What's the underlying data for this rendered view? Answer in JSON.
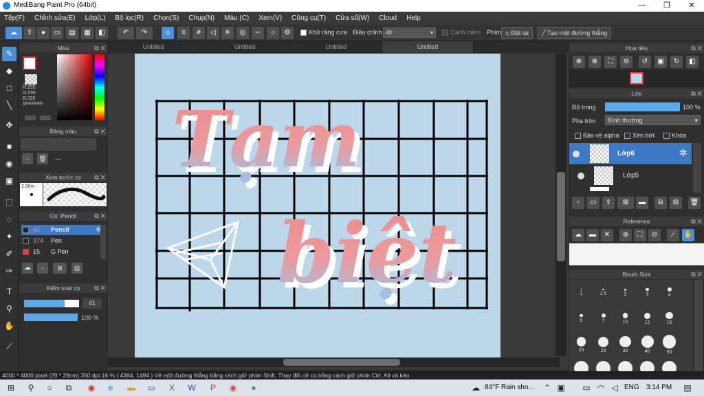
{
  "window": {
    "title": "MediBang Paint Pro (64bit)",
    "minimize": "—",
    "maximize": "❐",
    "close": "✕"
  },
  "menu": [
    "Tệp(F)",
    "Chỉnh sửa(E)",
    "Lớp(L)",
    "Bộ lọc(R)",
    "Chọn(S)",
    "Chụp(N)",
    "Màu (C)",
    "Xem(V)",
    "Công cụ(T)",
    "Cửa sổ(W)",
    "Cloud",
    "Help"
  ],
  "toolbar": {
    "antialias_label": "Khử răng cưa",
    "adjust_label": "Điều chỉnh",
    "adjust_value": "40",
    "soft_edge_label": "Cạnh mềm",
    "key_label": "Phím",
    "reset_label": "Đặt lại",
    "straight_line_label": "Tạo một đường thẳng"
  },
  "tabs": [
    "Untitled",
    "Untitled",
    "Untitled",
    "Untitled"
  ],
  "color_panel": {
    "title": "Màu",
    "r": "R:255",
    "g": "G:255",
    "b": "B:255",
    "hex": "#FFFFFF"
  },
  "palette_panel": {
    "title": "Bảng màu",
    "value": "---"
  },
  "preview_panel": {
    "title": "Xem trước cọ",
    "size": "2.98m"
  },
  "brush_panel": {
    "title": "Cọ: Pencil",
    "brushes": [
      {
        "size": "41",
        "name": "Pencil",
        "color": "#222222"
      },
      {
        "size": "374",
        "name": "Pen",
        "color": "#222222"
      },
      {
        "size": "15",
        "name": "G Pen",
        "color": "#e53935"
      }
    ]
  },
  "brush_control": {
    "title": "Kiểm soát cọ",
    "size_value": "41",
    "opacity_value": "100 %",
    "size_fraction": 0.74,
    "opacity_fraction": 1.0
  },
  "navigator_panel": {
    "title": "Hoa tiêu"
  },
  "layer_panel": {
    "title": "Lớp",
    "opacity_label": "Độ trong",
    "opacity_value": "100 %",
    "opacity_fraction": 1.0,
    "blend_label": "Pha trộn",
    "blend_value": "Bình thường",
    "protect_alpha": "Bảo vệ alpha",
    "clipping": "Xén bớt",
    "lock": "Khóa",
    "layers": [
      "Lớp6",
      "Lớp5"
    ]
  },
  "reference_panel": {
    "title": "Reference"
  },
  "brush_size_panel": {
    "title": "Brush Size",
    "sizes": [
      "1",
      "1.5",
      "2",
      "3",
      "4",
      "5",
      "7",
      "10",
      "12",
      "15",
      "20",
      "25",
      "30",
      "40",
      "50"
    ]
  },
  "status": {
    "text": "4000 * 4000 pixel   (29 * 29cm)   350 dpi   16 %   ( 4384, 1494 )   Vẽ một đường thẳng bằng cách giữ phím Shift, Thay đổi cỡ cọ bằng cách giữ phím Ctrl, Alt và kéo"
  },
  "taskbar": {
    "weather": "84°F  Rain sho...",
    "lang": "ENG",
    "time": "3:14 PM"
  },
  "artwork": {
    "word1": "Tạm",
    "word2": "biệt"
  },
  "colors": {
    "accent": "#4a90d9",
    "text_pink": "#e58a8c",
    "text_blue": "#9cc7ec",
    "paper": "#bcd6ea"
  }
}
